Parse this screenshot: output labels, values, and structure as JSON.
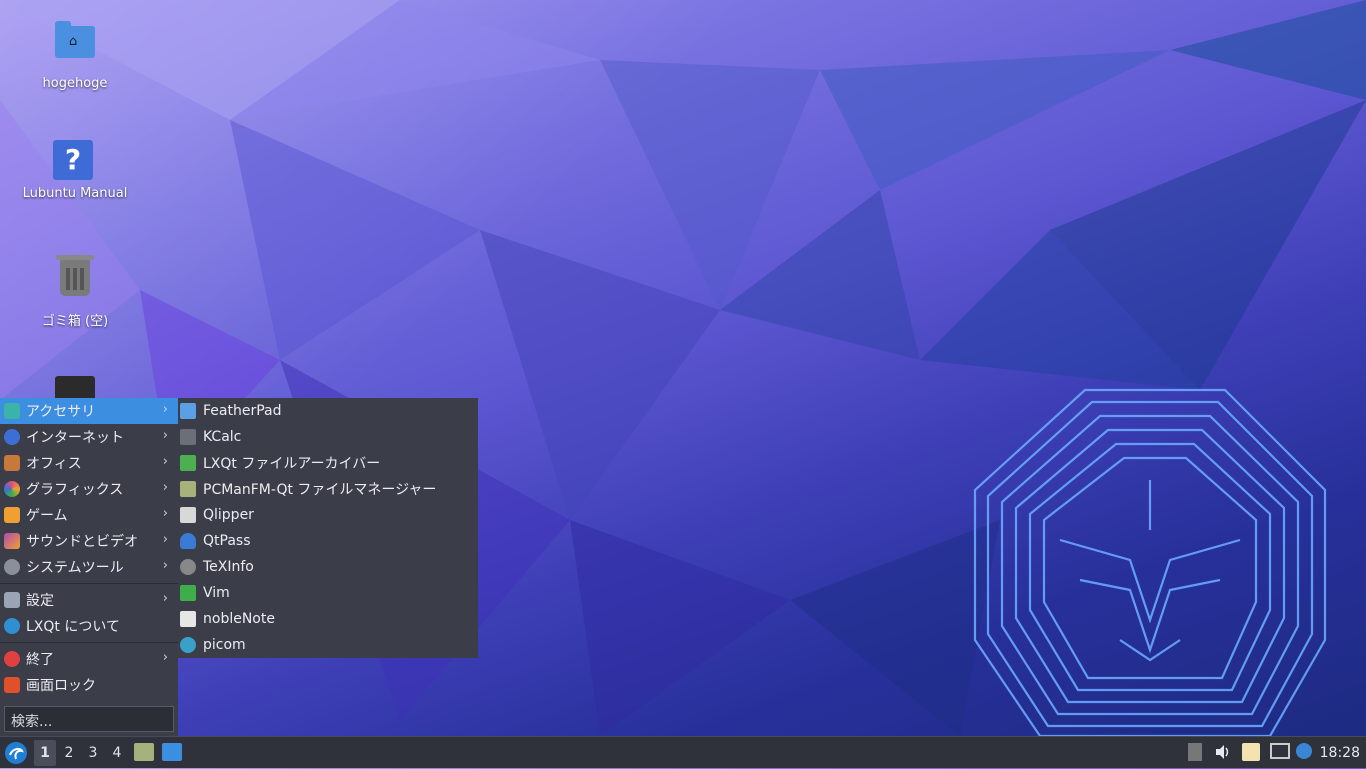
{
  "desktop": {
    "icons": [
      {
        "label": "hogehoge",
        "icon": "home-folder-icon"
      },
      {
        "label": "Lubuntu Manual",
        "icon": "help-icon"
      },
      {
        "label": "ゴミ箱 (空)",
        "icon": "trash-icon"
      }
    ]
  },
  "menu": {
    "items": [
      {
        "label": "アクセサリ",
        "icon": "accessories-icon",
        "submenu": true,
        "active": true,
        "color": "#3bb3a8"
      },
      {
        "label": "インターネット",
        "icon": "internet-icon",
        "submenu": true,
        "color": "#3b6fd6"
      },
      {
        "label": "オフィス",
        "icon": "office-icon",
        "submenu": true,
        "color": "#c7783a"
      },
      {
        "label": "グラフィックス",
        "icon": "graphics-icon",
        "submenu": true,
        "color": "#e0507a"
      },
      {
        "label": "ゲーム",
        "icon": "games-icon",
        "submenu": true,
        "color": "#f0a030"
      },
      {
        "label": "サウンドとビデオ",
        "icon": "multimedia-icon",
        "submenu": true,
        "color": "#b04ab0"
      },
      {
        "label": "システムツール",
        "icon": "system-tools-icon",
        "submenu": true,
        "color": "#8a8f9a"
      }
    ],
    "settings_label": "設定",
    "about_label": "LXQt について",
    "shutdown_label": "終了",
    "lock_label": "画面ロック",
    "search_placeholder": "検索..."
  },
  "submenu": {
    "items": [
      {
        "label": "FeatherPad",
        "icon": "featherpad-icon",
        "color": "#5aa0e6"
      },
      {
        "label": "KCalc",
        "icon": "calculator-icon",
        "color": "#6b6f78"
      },
      {
        "label": "LXQt ファイルアーカイバー",
        "icon": "archiver-icon",
        "color": "#4caf50"
      },
      {
        "label": "PCManFM-Qt ファイルマネージャー",
        "icon": "file-manager-icon",
        "color": "#a7b27a"
      },
      {
        "label": "Qlipper",
        "icon": "clipboard-icon",
        "color": "#d8d8d8"
      },
      {
        "label": "QtPass",
        "icon": "lock-icon",
        "color": "#3a7bd5"
      },
      {
        "label": "TeXInfo",
        "icon": "info-icon",
        "color": "#888888"
      },
      {
        "label": "Vim",
        "icon": "vim-icon",
        "color": "#3fae4a"
      },
      {
        "label": "nobleNote",
        "icon": "note-icon",
        "color": "#e6e6e6"
      },
      {
        "label": "picom",
        "icon": "gear-icon",
        "color": "#3aa0c8"
      }
    ]
  },
  "taskbar": {
    "desktops": [
      "1",
      "2",
      "3",
      "4"
    ],
    "current_desktop": "1",
    "clock": "18:28"
  }
}
